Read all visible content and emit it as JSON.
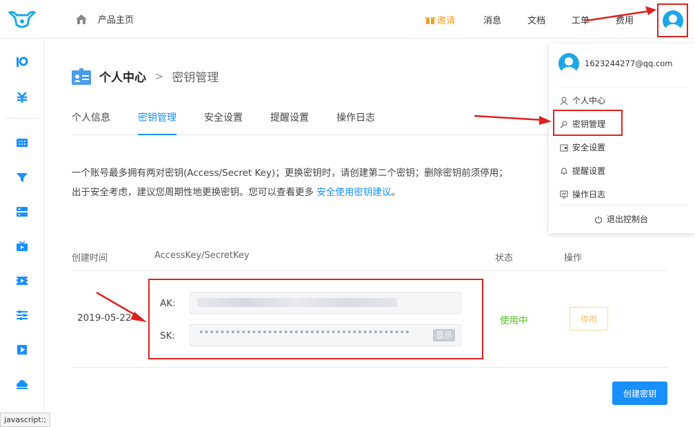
{
  "header": {
    "home_label": "产品主页",
    "nav": [
      {
        "label": "邀请",
        "icon": "gift-icon"
      },
      {
        "label": "消息"
      },
      {
        "label": "文档"
      },
      {
        "label": "工单"
      },
      {
        "label": "费用"
      }
    ]
  },
  "sidebar": {
    "icons": [
      "brand-icon",
      "currency-icon",
      "grid-icon",
      "funnel-icon",
      "server-icon",
      "tv-icon",
      "video-icon",
      "sliders-icon",
      "play-icon",
      "cloud-icon"
    ]
  },
  "breadcrumb": {
    "level1": "个人中心",
    "separator": ">",
    "level2": "密钥管理"
  },
  "tabs": [
    "个人信息",
    "密钥管理",
    "安全设置",
    "提醒设置",
    "操作日志"
  ],
  "active_tab": "密钥管理",
  "description": {
    "text": "一个账号最多拥有两对密钥(Access/Secret Key)；更换密钥时，请创建第二个密钥；删除密钥前须停用；出于安全考虑，建议您周期性地更换密钥。您可以查看更多 ",
    "link": "安全使用密钥建议",
    "end": "。"
  },
  "table": {
    "headers": [
      "创建时间",
      "AccessKey/SecretKey",
      "状态",
      "操作"
    ],
    "row": {
      "date": "2019-05-22",
      "ak_label": "AK:",
      "sk_label": "SK:",
      "sk_mask": "••••••••••••••••••••••••••••••••••••••••",
      "show_label": "显示",
      "status": "使用中",
      "action": "停用"
    }
  },
  "create_button": "创建密钥",
  "status_bar": "javascript:;",
  "dropdown": {
    "email": "1623244277@qq.com",
    "items": [
      {
        "label": "个人中心",
        "icon": "user-icon"
      },
      {
        "label": "密钥管理",
        "icon": "key-icon"
      },
      {
        "label": "安全设置",
        "icon": "shield-icon"
      },
      {
        "label": "提醒设置",
        "icon": "bell-icon"
      },
      {
        "label": "操作日志",
        "icon": "log-icon"
      }
    ],
    "logout": "退出控制台"
  },
  "colors": {
    "accent": "#1890ff",
    "annotation": "#e02020",
    "status_active": "#52c41a",
    "invite": "#f0a020"
  }
}
